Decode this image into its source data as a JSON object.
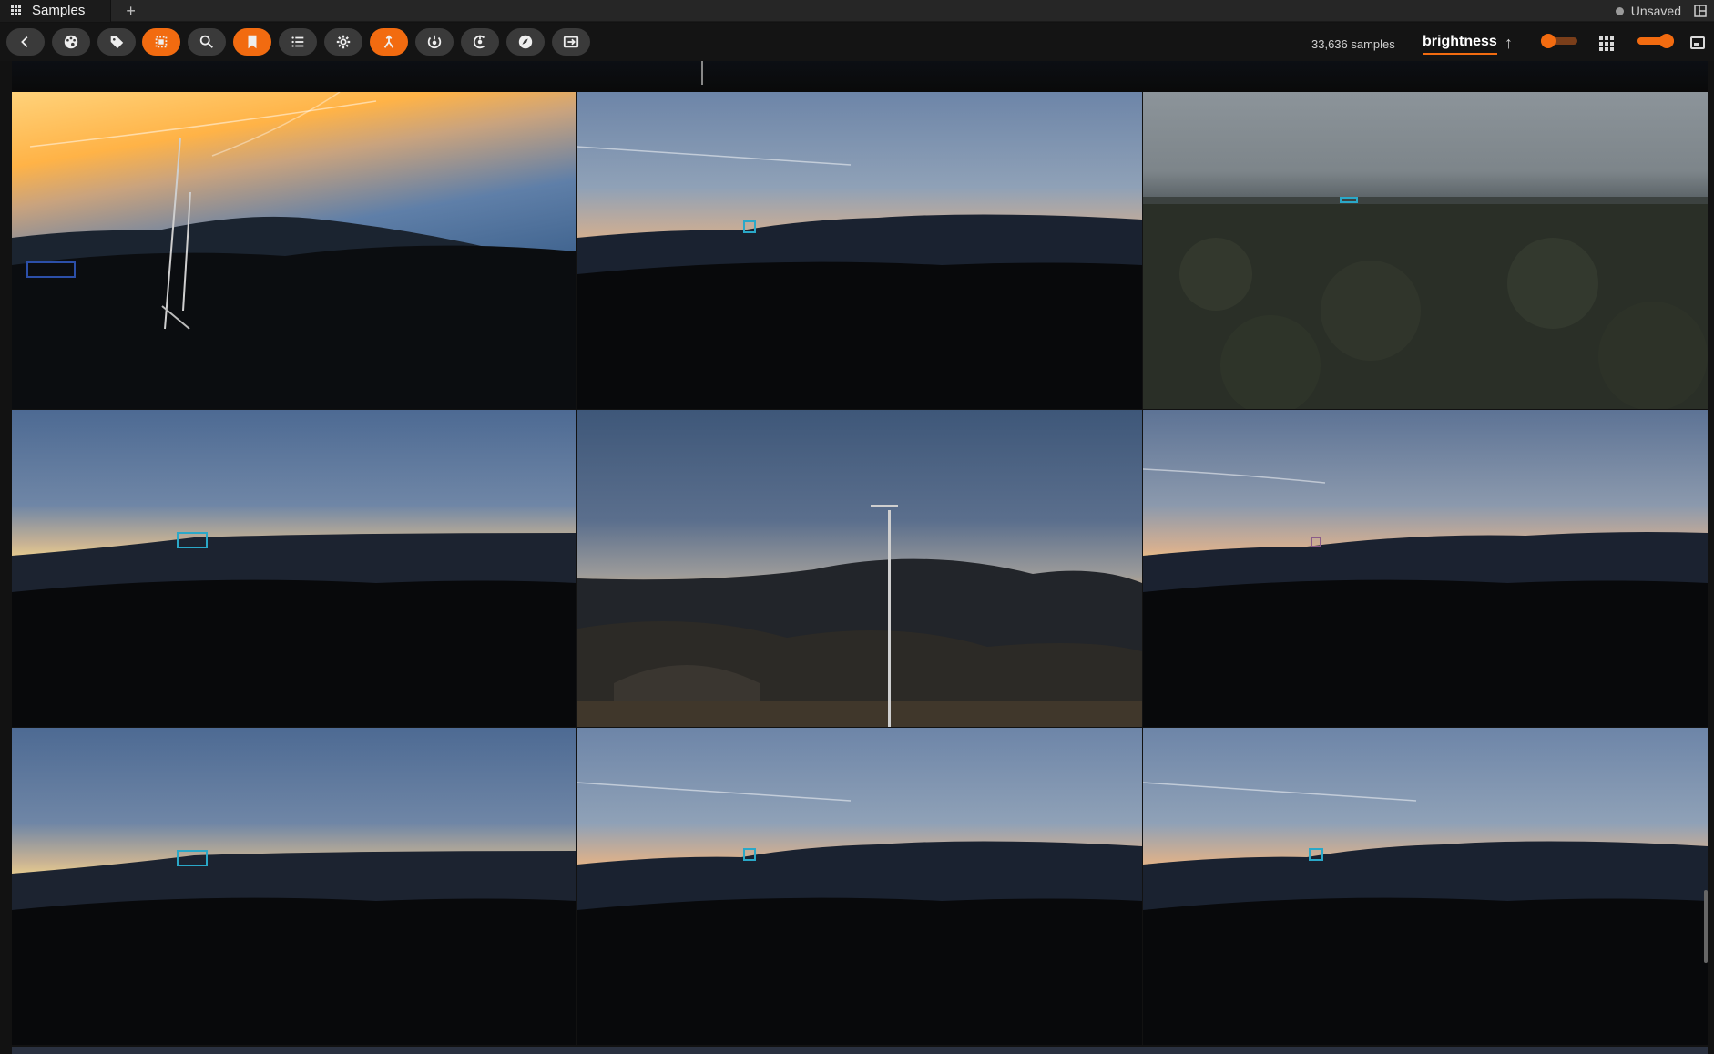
{
  "titlebar": {
    "tab_label": "Samples",
    "new_tab_symbol": "+",
    "status_text": "Unsaved"
  },
  "toolbar": {
    "buttons": [
      {
        "name": "back-button",
        "icon": "chevron-left-icon",
        "active": false
      },
      {
        "name": "color-by-button",
        "icon": "palette-icon",
        "active": false
      },
      {
        "name": "tag-button",
        "icon": "tag-icon",
        "active": false
      },
      {
        "name": "select-all-button",
        "icon": "select-icon",
        "active": true
      },
      {
        "name": "search-button",
        "icon": "search-icon",
        "active": false
      },
      {
        "name": "bookmark-button",
        "icon": "bookmark-icon",
        "active": true
      },
      {
        "name": "list-button",
        "icon": "list-icon",
        "active": false
      },
      {
        "name": "settings-button",
        "icon": "gear-icon",
        "active": false
      },
      {
        "name": "patches-button",
        "icon": "merge-icon",
        "active": true
      },
      {
        "name": "similarity-button",
        "icon": "similarity-icon",
        "active": false
      },
      {
        "name": "group-button",
        "icon": "group-icon",
        "active": false
      },
      {
        "name": "operator-button",
        "icon": "compass-icon",
        "active": false
      },
      {
        "name": "export-button",
        "icon": "export-icon",
        "active": false
      }
    ],
    "sample_count": "33,636 samples",
    "sort_field": "brightness",
    "sort_direction": "ascending",
    "colors": {
      "accent": "#f26b10",
      "button": "#3a3a3a"
    }
  },
  "gallery": {
    "columns": 3,
    "rows_visible": 3,
    "annotation_color": "#2aa8c8",
    "tiles": [
      {
        "scene": "sunset-with-antenna"
      },
      {
        "scene": "sunset-mountains"
      },
      {
        "scene": "forest-overcast"
      },
      {
        "scene": "sunset-horizon"
      },
      {
        "scene": "weather-station-pole"
      },
      {
        "scene": "sunset-horizon"
      },
      {
        "scene": "sunset-horizon"
      },
      {
        "scene": "sunset-mountains"
      },
      {
        "scene": "sunset-mountains"
      }
    ]
  }
}
